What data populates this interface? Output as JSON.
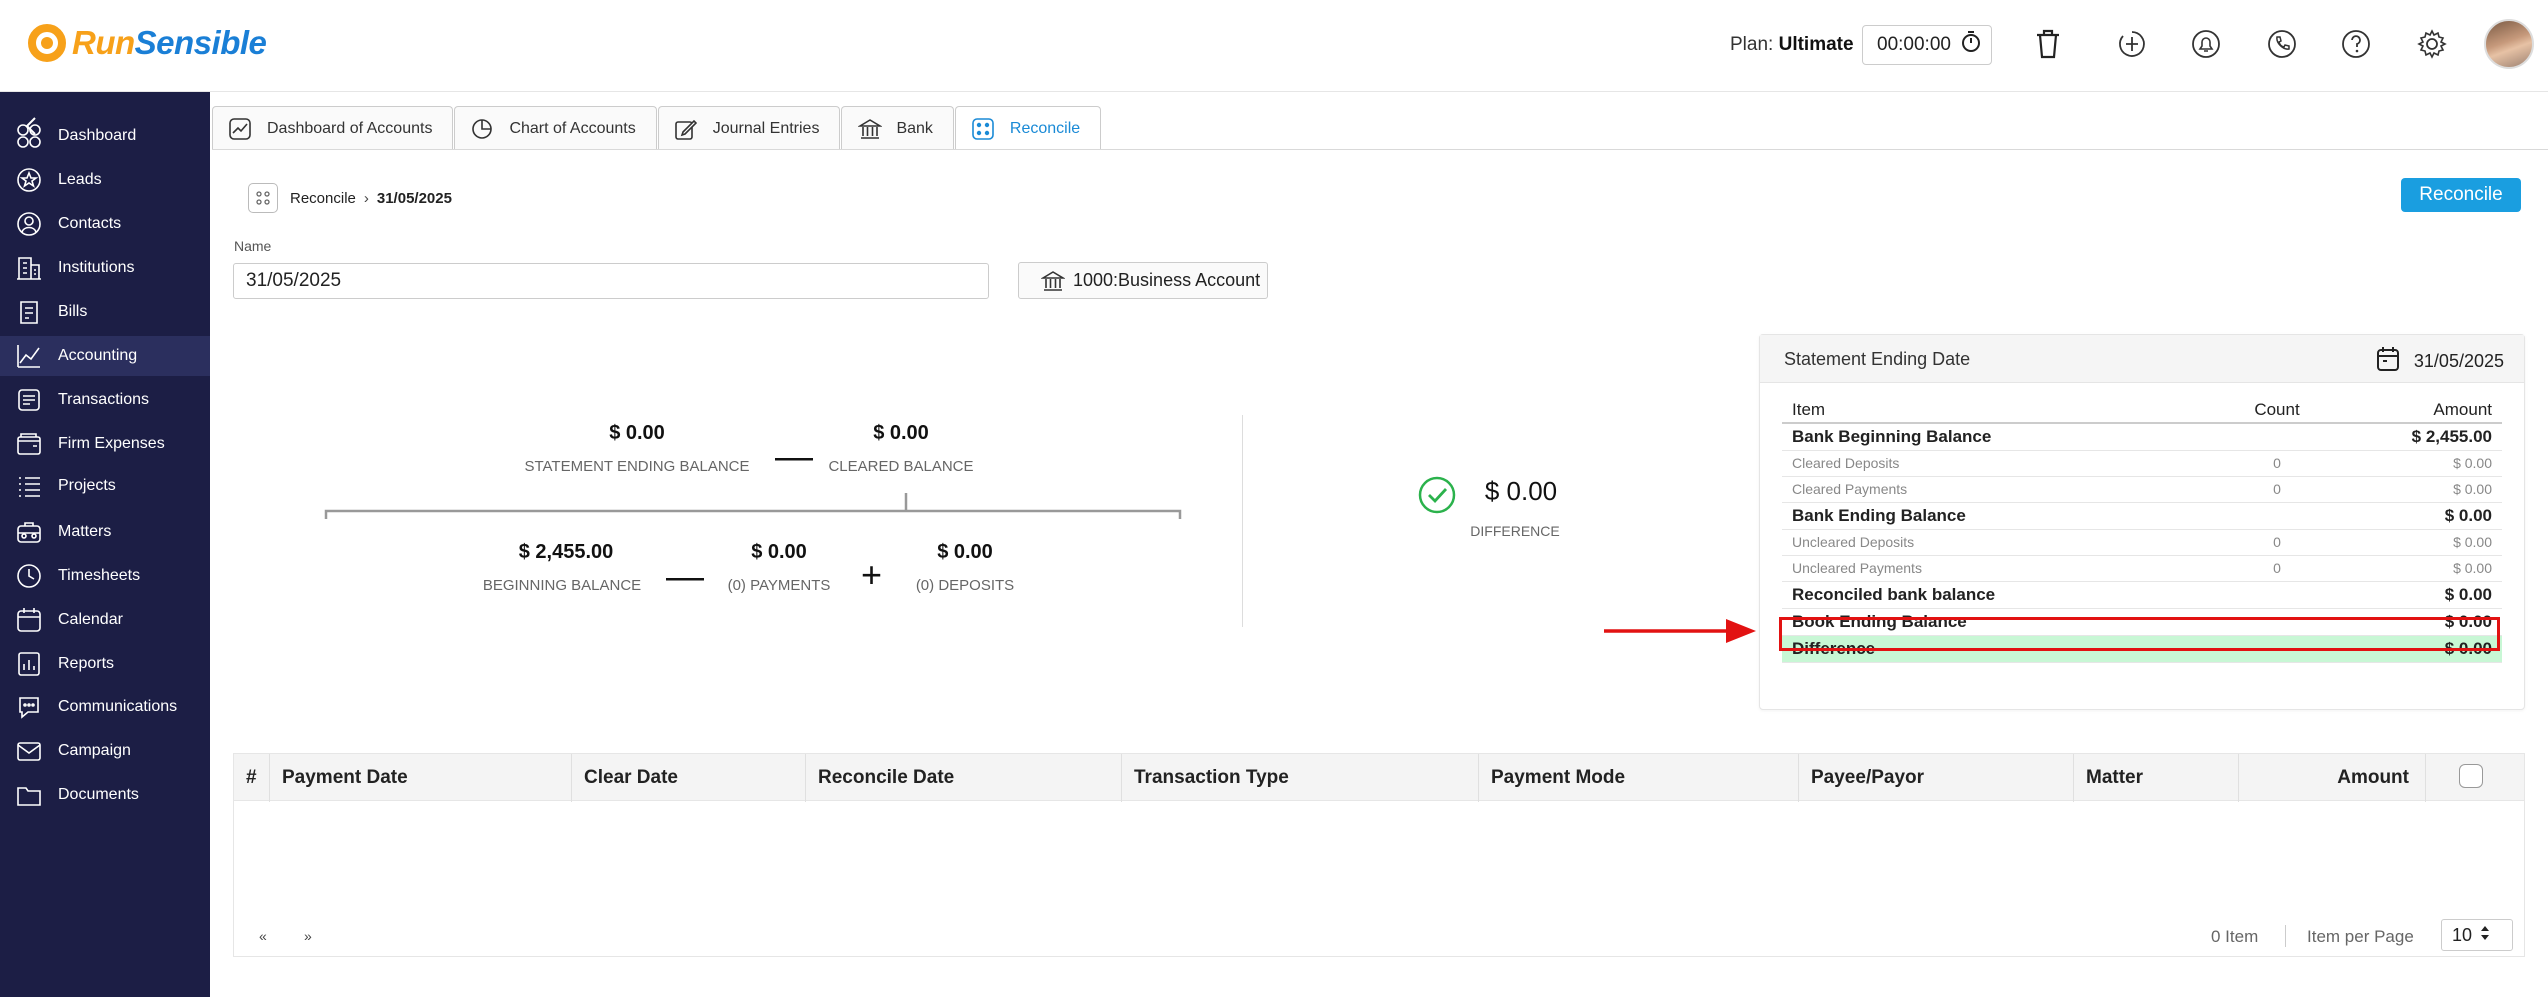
{
  "brand": {
    "logo_part1": "Run",
    "logo_part2": "Sensible"
  },
  "header": {
    "plan_label": "Plan:",
    "plan_name": "Ultimate",
    "timer": "00:00:00"
  },
  "header_icons": [
    "trash-icon",
    "add-call-icon",
    "bell-icon",
    "phone-icon",
    "help-icon",
    "gear-icon"
  ],
  "sidebar": {
    "items": [
      {
        "label": "Dashboard",
        "icon": "dashboard-icon"
      },
      {
        "label": "Leads",
        "icon": "star-icon"
      },
      {
        "label": "Contacts",
        "icon": "contact-icon"
      },
      {
        "label": "Institutions",
        "icon": "building-icon"
      },
      {
        "label": "Bills",
        "icon": "bill-icon"
      },
      {
        "label": "Accounting",
        "icon": "chart-icon",
        "active": true
      },
      {
        "label": "Transactions",
        "icon": "transactions-icon"
      },
      {
        "label": "Firm Expenses",
        "icon": "wallet-icon"
      },
      {
        "label": "Projects",
        "icon": "list-icon"
      },
      {
        "label": "Matters",
        "icon": "briefcase-icon"
      },
      {
        "label": "Timesheets",
        "icon": "clock-icon"
      },
      {
        "label": "Calendar",
        "icon": "calendar-icon"
      },
      {
        "label": "Reports",
        "icon": "report-icon"
      },
      {
        "label": "Communications",
        "icon": "chat-icon"
      },
      {
        "label": "Campaign",
        "icon": "mail-icon"
      },
      {
        "label": "Documents",
        "icon": "folder-icon"
      }
    ]
  },
  "tabs": [
    {
      "label": "Dashboard of Accounts"
    },
    {
      "label": "Chart of Accounts"
    },
    {
      "label": "Journal Entries"
    },
    {
      "label": "Bank"
    },
    {
      "label": "Reconcile",
      "active": true
    }
  ],
  "breadcrumb": {
    "section": "Reconcile",
    "current": "31/05/2025"
  },
  "actions": {
    "reconcile_label": "Reconcile"
  },
  "form": {
    "name_label": "Name",
    "name_value": "31/05/2025",
    "account_label": "1000:Business Account"
  },
  "summary": {
    "statement_ending_value": "$ 0.00",
    "statement_ending_label": "STATEMENT ENDING BALANCE",
    "cleared_value": "$ 0.00",
    "cleared_label": "CLEARED BALANCE",
    "beginning_value": "$ 2,455.00",
    "beginning_label": "BEGINNING BALANCE",
    "payments_value": "$ 0.00",
    "payments_label": "(0) PAYMENTS",
    "deposits_value": "$ 0.00",
    "deposits_label": "(0) DEPOSITS",
    "difference_value": "$ 0.00",
    "difference_label": "DIFFERENCE"
  },
  "panel": {
    "title": "Statement Ending Date",
    "date": "31/05/2025",
    "columns": {
      "item": "Item",
      "count": "Count",
      "amount": "Amount"
    },
    "rows": [
      {
        "item": "Bank Beginning Balance",
        "count": "",
        "amount": "$ 2,455.00",
        "kind": "main"
      },
      {
        "item": "Cleared Deposits",
        "count": "0",
        "amount": "$ 0.00",
        "kind": "sub"
      },
      {
        "item": "Cleared Payments",
        "count": "0",
        "amount": "$ 0.00",
        "kind": "sub"
      },
      {
        "item": "Bank Ending Balance",
        "count": "",
        "amount": "$ 0.00",
        "kind": "main"
      },
      {
        "item": "Uncleared Deposits",
        "count": "0",
        "amount": "$ 0.00",
        "kind": "sub"
      },
      {
        "item": "Uncleared Payments",
        "count": "0",
        "amount": "$ 0.00",
        "kind": "sub"
      },
      {
        "item": "Reconciled bank balance",
        "count": "",
        "amount": "$ 0.00",
        "kind": "main"
      },
      {
        "item": "Book Ending Balance",
        "count": "",
        "amount": "$ 0.00",
        "kind": "main"
      },
      {
        "item": "Difference",
        "count": "",
        "amount": "$ 0.00",
        "kind": "main"
      }
    ]
  },
  "grid": {
    "columns": [
      "#",
      "Payment Date",
      "Clear Date",
      "Reconcile Date",
      "Transaction Type",
      "Payment Mode",
      "Payee/Payor",
      "Matter",
      "Amount"
    ],
    "pager_prev": "«",
    "pager_next": "»",
    "item_count": "0 Item",
    "per_page_label": "Item per Page",
    "per_page_value": "10"
  },
  "colors": {
    "accent": "#1a9ee0",
    "sidebar_bg": "#1c1e45",
    "highlight": "#e21212",
    "difference_bg": "#c8f7d5",
    "logo_orange": "#f7a11a",
    "logo_blue": "#1a7fd6"
  }
}
